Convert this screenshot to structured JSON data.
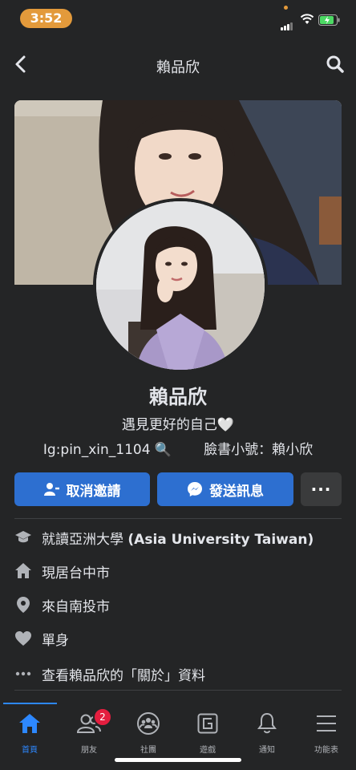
{
  "status_bar": {
    "time": "3:52"
  },
  "header": {
    "title": "賴品欣"
  },
  "profile": {
    "name": "賴品欣",
    "bio_line1": "遇見更好的自己🤍",
    "bio_ig": "Ig:pin_xin_1104 🔍",
    "bio_alt": "臉書小號：賴小欣"
  },
  "actions": {
    "cancel_request": "取消邀請",
    "send_message": "發送訊息",
    "more": "···"
  },
  "info": {
    "education_prefix": "就讀亞洲大學 ",
    "education_bold": "(Asia University Taiwan)",
    "lives_in": "現居台中市",
    "from": "來自南投市",
    "relationship": "單身",
    "see_about": "查看賴品欣的「關於」資料"
  },
  "tabs": [
    {
      "label": "首頁"
    },
    {
      "label": "朋友",
      "badge": "2"
    },
    {
      "label": "社團"
    },
    {
      "label": "遊戲"
    },
    {
      "label": "通知"
    },
    {
      "label": "功能表"
    }
  ],
  "colors": {
    "accent": "#2d6fd0",
    "active_tab": "#2d88ff",
    "badge": "#e41e3f",
    "time_pill": "#e39a3b"
  }
}
